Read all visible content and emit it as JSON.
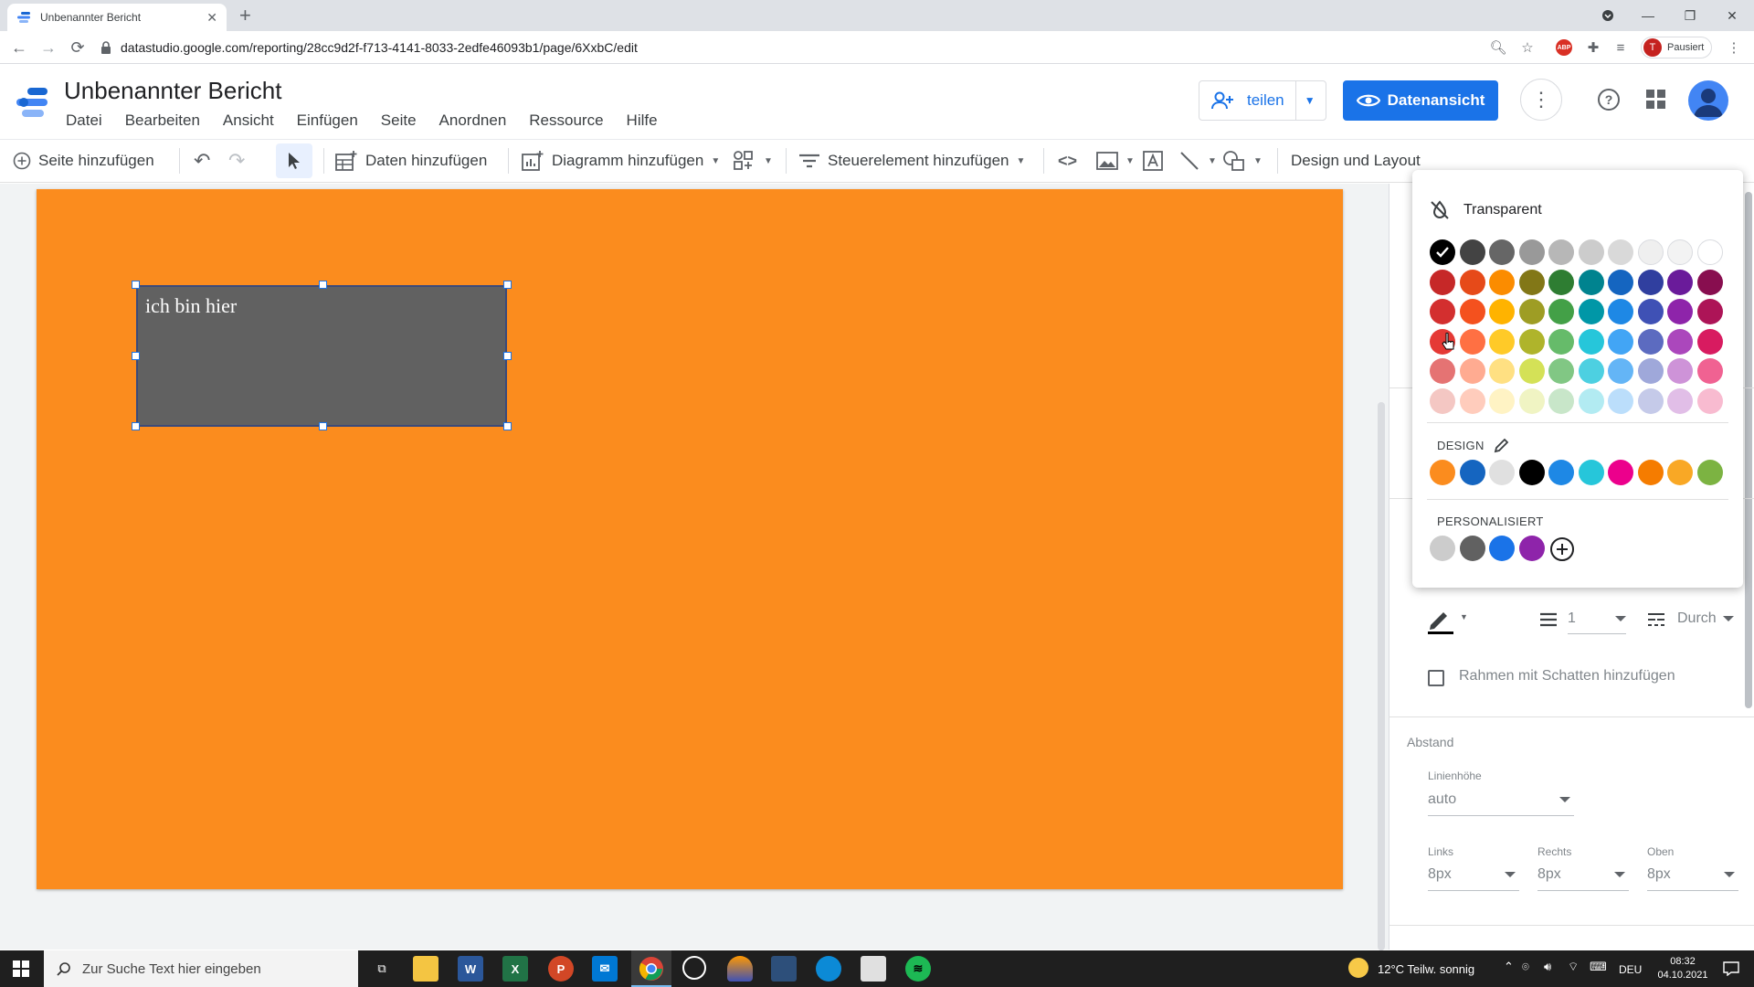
{
  "browser": {
    "tab_title": "Unbenannter Bericht",
    "url": "datastudio.google.com/reporting/28cc9d2f-f713-4141-8033-2edfe46093b1/page/6XxbC/edit",
    "profile_initial": "T",
    "profile_status": "Pausiert"
  },
  "app": {
    "title": "Unbenannter Bericht",
    "menu": [
      "Datei",
      "Bearbeiten",
      "Ansicht",
      "Einfügen",
      "Seite",
      "Anordnen",
      "Ressource",
      "Hilfe"
    ],
    "share_label": "teilen",
    "view_label": "Datenansicht"
  },
  "toolbar": {
    "add_page": "Seite hinzufügen",
    "add_data": "Daten hinzufügen",
    "add_chart": "Diagramm hinzufügen",
    "add_control": "Steuerelement hinzufügen",
    "theme_layout": "Design und Layout"
  },
  "canvas": {
    "background_color": "#fb8c1e",
    "textbox_text": "ich bin hier",
    "textbox_fill": "#616161"
  },
  "color_picker": {
    "transparent_label": "Transparent",
    "grid": [
      [
        "#000000",
        "#434343",
        "#666666",
        "#999999",
        "#b7b7b7",
        "#cccccc",
        "#d9d9d9",
        "#efefef",
        "#f3f3f3",
        "#ffffff"
      ],
      [
        "#c62828",
        "#e64a19",
        "#fb8c00",
        "#827717",
        "#2e7d32",
        "#00838f",
        "#1565c0",
        "#303f9f",
        "#6a1b9a",
        "#880e4f"
      ],
      [
        "#d32f2f",
        "#f4511e",
        "#ffb300",
        "#9e9d24",
        "#43a047",
        "#0097a7",
        "#1e88e5",
        "#3f51b5",
        "#8e24aa",
        "#ad1457"
      ],
      [
        "#e53935",
        "#ff7043",
        "#ffca28",
        "#afb42b",
        "#66bb6a",
        "#26c6da",
        "#42a5f5",
        "#5c6bc0",
        "#ab47bc",
        "#d81b60"
      ],
      [
        "#e57373",
        "#ffab91",
        "#ffe082",
        "#d4e157",
        "#81c784",
        "#4dd0e1",
        "#64b5f6",
        "#9fa8da",
        "#ce93d8",
        "#f06292"
      ],
      [
        "#f4c7c3",
        "#ffccbc",
        "#fff3c4",
        "#f0f4c3",
        "#c8e6c9",
        "#b2ebf2",
        "#bbdefb",
        "#c5cae9",
        "#e1bee7",
        "#f8bbd0"
      ]
    ],
    "design_label": "DESIGN",
    "design_colors": [
      "#fb8c1e",
      "#1565c0",
      "#e0e0e0",
      "#000000",
      "#1e88e5",
      "#26c6da",
      "#ec008c",
      "#f57c00",
      "#f9a825",
      "#7cb342"
    ],
    "custom_label": "PERSONALISIERT",
    "custom_colors": [
      "#cccccc",
      "#616161",
      "#1a73e8",
      "#8e24aa"
    ]
  },
  "panel": {
    "border_weight": "1",
    "border_style": "Durch",
    "shadow_label": "Rahmen mit Schatten hinzufügen",
    "spacing_label": "Abstand",
    "line_height_label": "Linienhöhe",
    "line_height_value": "auto",
    "padding": [
      {
        "label": "Links",
        "value": "8px"
      },
      {
        "label": "Rechts",
        "value": "8px"
      },
      {
        "label": "Oben",
        "value": "8px"
      }
    ]
  },
  "taskbar": {
    "search_placeholder": "Zur Suche Text hier eingeben",
    "weather": "12°C Teilw. sonnig",
    "lang": "DEU",
    "time": "08:32",
    "date": "04.10.2021"
  }
}
